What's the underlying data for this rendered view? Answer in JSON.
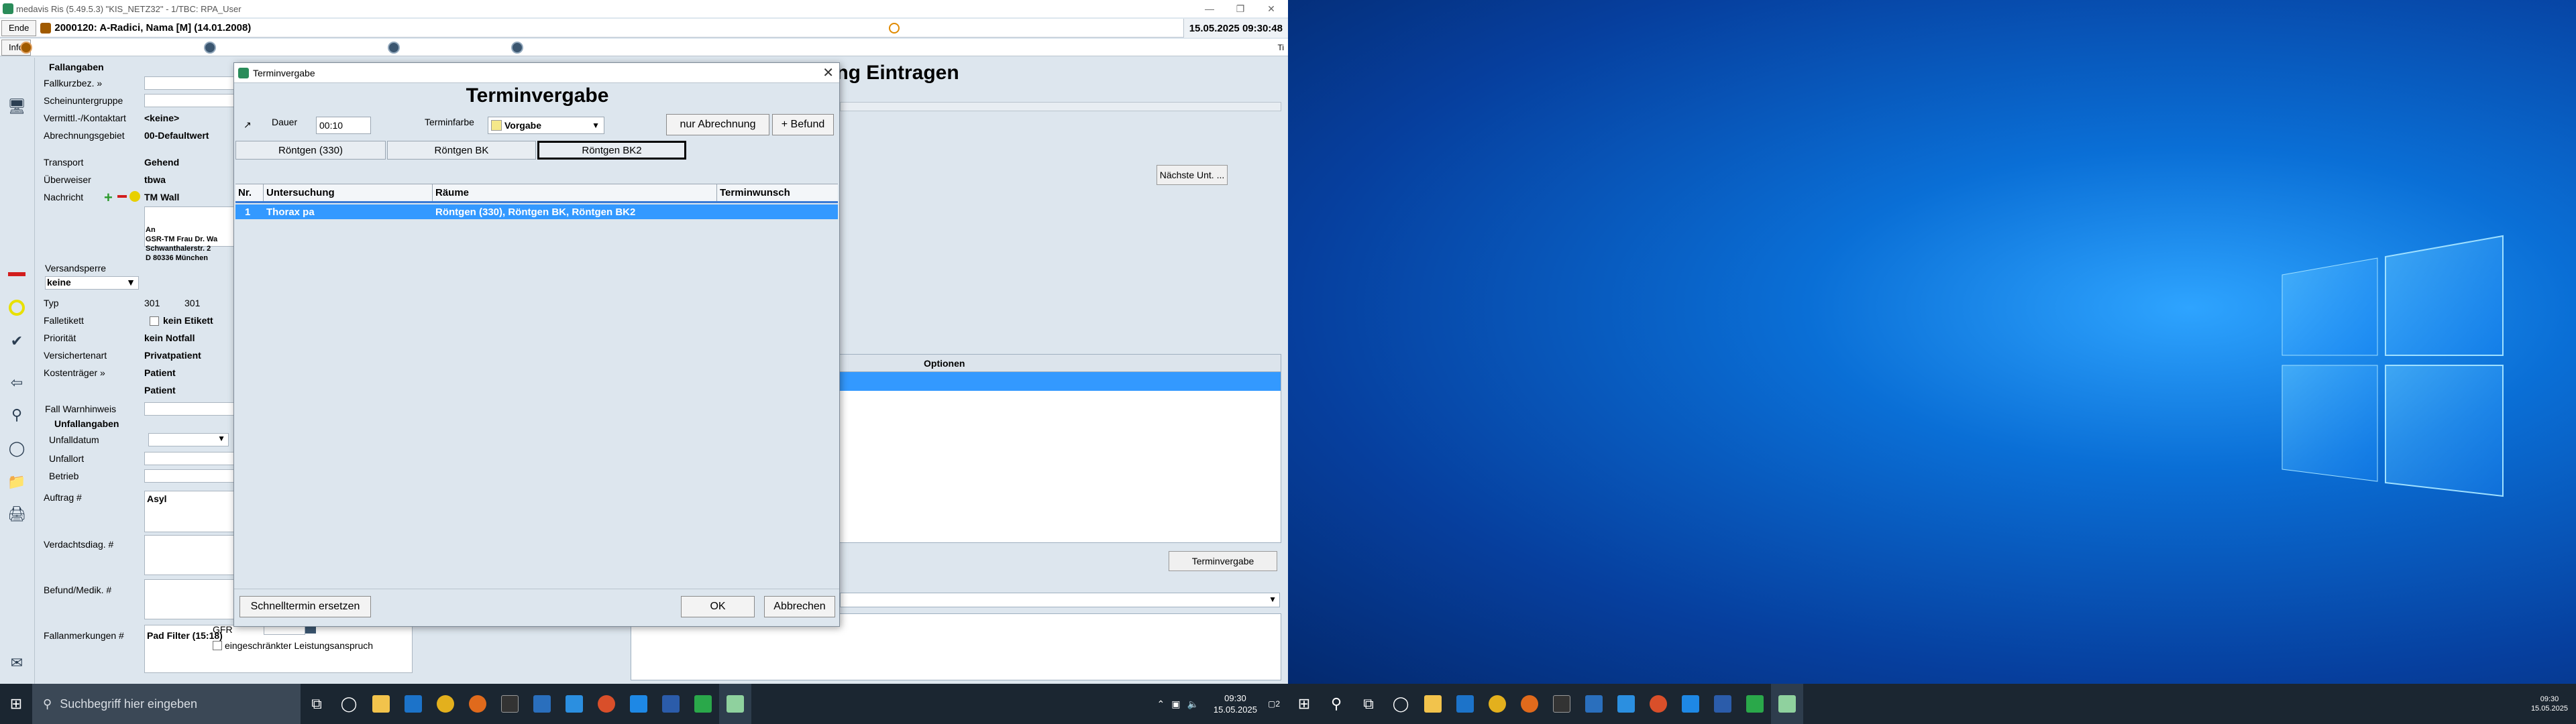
{
  "window": {
    "title": "medavis Ris (5.49.5.3) \"KIS_NETZ32\" - 1/TBC: RPA_User",
    "end_label": "Ende",
    "info_label": "Info",
    "patient": "2000120: A-Radici, Nama [M] (14.01.2008)",
    "datetime": "15.05.2025 09:30:48",
    "corner_label": "Ti"
  },
  "form": {
    "section_fallangaben": "Fallangaben",
    "rows": [
      {
        "label": "Fallkurzbez. »",
        "value": ""
      },
      {
        "label": "Scheinuntergruppe",
        "value": ""
      },
      {
        "label": "Vermittl.-/Kontaktart",
        "value": "<keine>"
      },
      {
        "label": "Abrechnungsgebiet",
        "value": "00-Defaultwert"
      },
      {
        "label": "Transport",
        "value": "Gehend"
      },
      {
        "label": "Überweiser",
        "value": "tbwa"
      },
      {
        "label": "Nachricht",
        "value": "TM Wall"
      }
    ],
    "address": [
      "An",
      "GSR-TM Frau Dr. Wa",
      "Schwanthalerstr. 2",
      "D 80336 München"
    ],
    "versandsperre_label": "Versandsperre",
    "versandsperre_value": "keine",
    "typ_label": "Typ",
    "typ_value1": "301",
    "typ_value2": "301",
    "falletikett_label": "Falletikett",
    "falletikett_value": "kein Etikett",
    "prioritaet_label": "Priorität",
    "prioritaet_value": "kein Notfall",
    "versichertenart_label": "Versichertenart",
    "versichertenart_value": "Privatpatient",
    "kostentraeger_label": "Kostenträger »",
    "kostentraeger_value": "Patient",
    "kostentraeger_value2": "Patient",
    "warnhinweis_label": "Fall Warnhinweis",
    "unfall_section": "Unfallangaben",
    "unfalldatum_label": "Unfalldatum",
    "unfallort_label": "Unfallort",
    "betrieb_label": "Betrieb",
    "auftrag_label": "Auftrag #",
    "auftrag_value": "Asyl",
    "verdacht_label": "Verdachtsdiag. #",
    "befund_label": "Befund/Medik. #",
    "anmerkungen_label": "Fallanmerkungen #",
    "anmerkungen_value": "Pad Filter (15:18)",
    "gfr_label": "GFR",
    "eingeschraenkt_label": "eingeschränkter Leistungsanspruch"
  },
  "background": {
    "title": "ung Eintragen",
    "naechste_label": "Nächste Unt. ...",
    "optionen_header": "Optionen",
    "terminvergabe_label": "Terminvergabe"
  },
  "dialog": {
    "titlebar": "Terminvergabe",
    "heading": "Terminvergabe",
    "dauer_label": "Dauer",
    "dauer_value": "00:10",
    "terminfarbe_label": "Terminfarbe",
    "terminfarbe_value": "Vorgabe",
    "terminfarbe_color": "#f5e88a",
    "nur_abrechnung_label": "nur Abrechnung",
    "befund_label": "+ Befund",
    "rooms": [
      "Röntgen (330)",
      "Röntgen BK",
      "Röntgen BK2"
    ],
    "active_room": "Röntgen BK2",
    "columns": [
      "Nr.",
      "Untersuchung",
      "Räume",
      "Terminwunsch"
    ],
    "rows": [
      {
        "nr": "1",
        "untersuchung": "Thorax pa",
        "raeume": "Röntgen (330), Röntgen BK, Röntgen BK2",
        "terminwunsch": ""
      }
    ],
    "schnelltermin_label": "Schnelltermin ersetzen",
    "ok_label": "OK",
    "abbrechen_label": "Abbrechen"
  },
  "taskbar_left": {
    "search_placeholder": "Suchbegriff hier eingeben",
    "time": "09:30",
    "date": "15.05.2025",
    "notification_count": "2"
  },
  "taskbar_right": {
    "time": "09:30",
    "date": "15.05.2025"
  },
  "colors": {
    "accent": "#3399ff",
    "app_bg": "#dde6ee",
    "taskbar": "#1b2631"
  }
}
